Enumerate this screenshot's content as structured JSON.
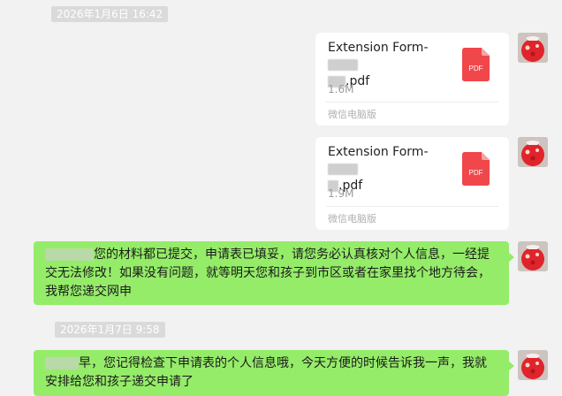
{
  "timestamps": [
    "2026年1月6日 16:42",
    "2026年1月7日 9:58"
  ],
  "files": [
    {
      "name_prefix": "Extension Form-",
      "name_suffix": ".pdf",
      "size": "1.6M",
      "source": "微信电脑版",
      "icon": "pdf-file-icon",
      "icon_label": "PDF"
    },
    {
      "name_prefix": "Extension Form-",
      "name_suffix": ".pdf",
      "size": "1.9M",
      "source": "微信电脑版",
      "icon": "pdf-file-icon",
      "icon_label": "PDF"
    }
  ],
  "messages": [
    {
      "text": "您的材料都已提交，申请表已填妥，请您务必认真核对个人信息，一经提交无法修改！如果没有问题，就等明天您和孩子到市区或者在家里找个地方待会，我帮您递交网申"
    },
    {
      "text": "早，您记得检查下申请表的个人信息哦，今天方便的时候告诉我一声，我就安排给您和孩子递交申请了"
    }
  ],
  "colors": {
    "bubble": "#95ec69",
    "background": "#f2f2f2",
    "pdf": "#f0474b"
  },
  "avatar_icon": "user-avatar"
}
